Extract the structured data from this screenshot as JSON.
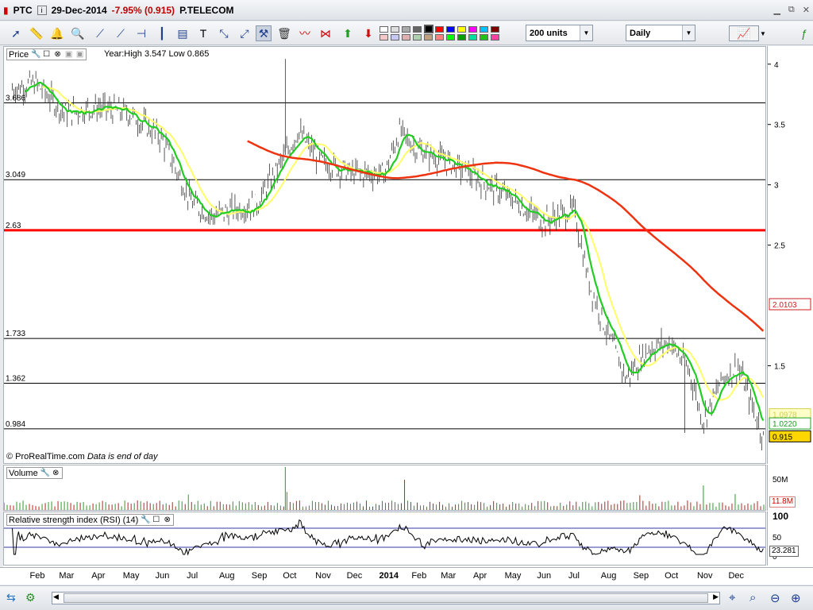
{
  "title": {
    "symbol": "PTC",
    "date": "29-Dec-2014",
    "change": "-7.95% (0.915)",
    "name": "P.TELECOM"
  },
  "toolbar": {
    "units_value": "200 units",
    "period_value": "Daily"
  },
  "price_panel": {
    "label": "Price",
    "info": "Year:High 3.547 Low 0.865",
    "copyright": "© ProRealTime.com",
    "note": "Data is end of day",
    "levels": [
      "3.686",
      "3.049",
      "2.63",
      "1.733",
      "1.362",
      "0.984"
    ],
    "scale": [
      "4",
      "3.5",
      "3",
      "2.5",
      "1.5"
    ],
    "tag_ma200": "2.0103",
    "tag_ma_green": "1.0220",
    "tag_ma_yellow": "1.0978",
    "tag_last": "0.915"
  },
  "volume_panel": {
    "label": "Volume",
    "scale_top": "50M",
    "tag_value": "11.8M"
  },
  "rsi_panel": {
    "label": "Relative strength index (RSI) (14)",
    "scale": [
      "100",
      "50",
      "0"
    ],
    "tag_value": "23.281"
  },
  "xaxis": [
    "Feb",
    "Mar",
    "Apr",
    "May",
    "Jun",
    "Jul",
    "Aug",
    "Sep",
    "Oct",
    "Nov",
    "Dec",
    "2014",
    "Feb",
    "Mar",
    "Apr",
    "May",
    "Jun",
    "Jul",
    "Aug",
    "Sep",
    "Oct",
    "Nov",
    "Dec"
  ],
  "colors": {
    "ma_fast": "#22cc22",
    "ma_mid": "#ffff66",
    "ma_slow": "#ee3311",
    "support": "#ff0000",
    "price_bars": "#333333",
    "rsi_line": "#000000",
    "rsi_band": "#3a3aa8",
    "last_tag": "#ffd700"
  },
  "chart_data": {
    "type": "line",
    "title": "",
    "series": [
      {
        "name": "",
        "x": [
          "2013-01-10",
          "2013-02-01",
          "2013-03-01",
          "2013-04-01",
          "2013-05-01",
          "2013-06-01",
          "2013-07-01",
          "2013-07-20",
          "2013-08-10",
          "2013-09-01",
          "2013-10-01",
          "2013-10-10",
          "2013-11-01",
          "2013-12-01",
          "2014-01-01",
          "2014-01-15",
          "2014-02-01",
          "2014-03-01",
          "2014-04-01",
          "2014-05-01",
          "2014-06-01",
          "2014-07-01",
          "2014-07-15",
          "2014-08-01",
          "2014-08-20",
          "2014-09-10",
          "2014-10-01",
          "2014-10-20",
          "2014-11-01",
          "2014-11-20",
          "2014-12-05",
          "2014-12-29"
        ],
        "values": [
          3.8,
          3.85,
          3.6,
          3.65,
          3.6,
          3.4,
          2.85,
          2.75,
          2.8,
          2.85,
          3.3,
          3.45,
          3.2,
          3.1,
          3.1,
          3.45,
          3.3,
          3.2,
          3.05,
          2.9,
          2.7,
          2.8,
          2.2,
          1.8,
          1.4,
          1.65,
          1.7,
          1.45,
          1.05,
          1.4,
          1.5,
          0.915
        ]
      }
    ],
    "ylim": [
      0.7,
      4.15
    ],
    "xlabel": "",
    "ylabel": ""
  }
}
